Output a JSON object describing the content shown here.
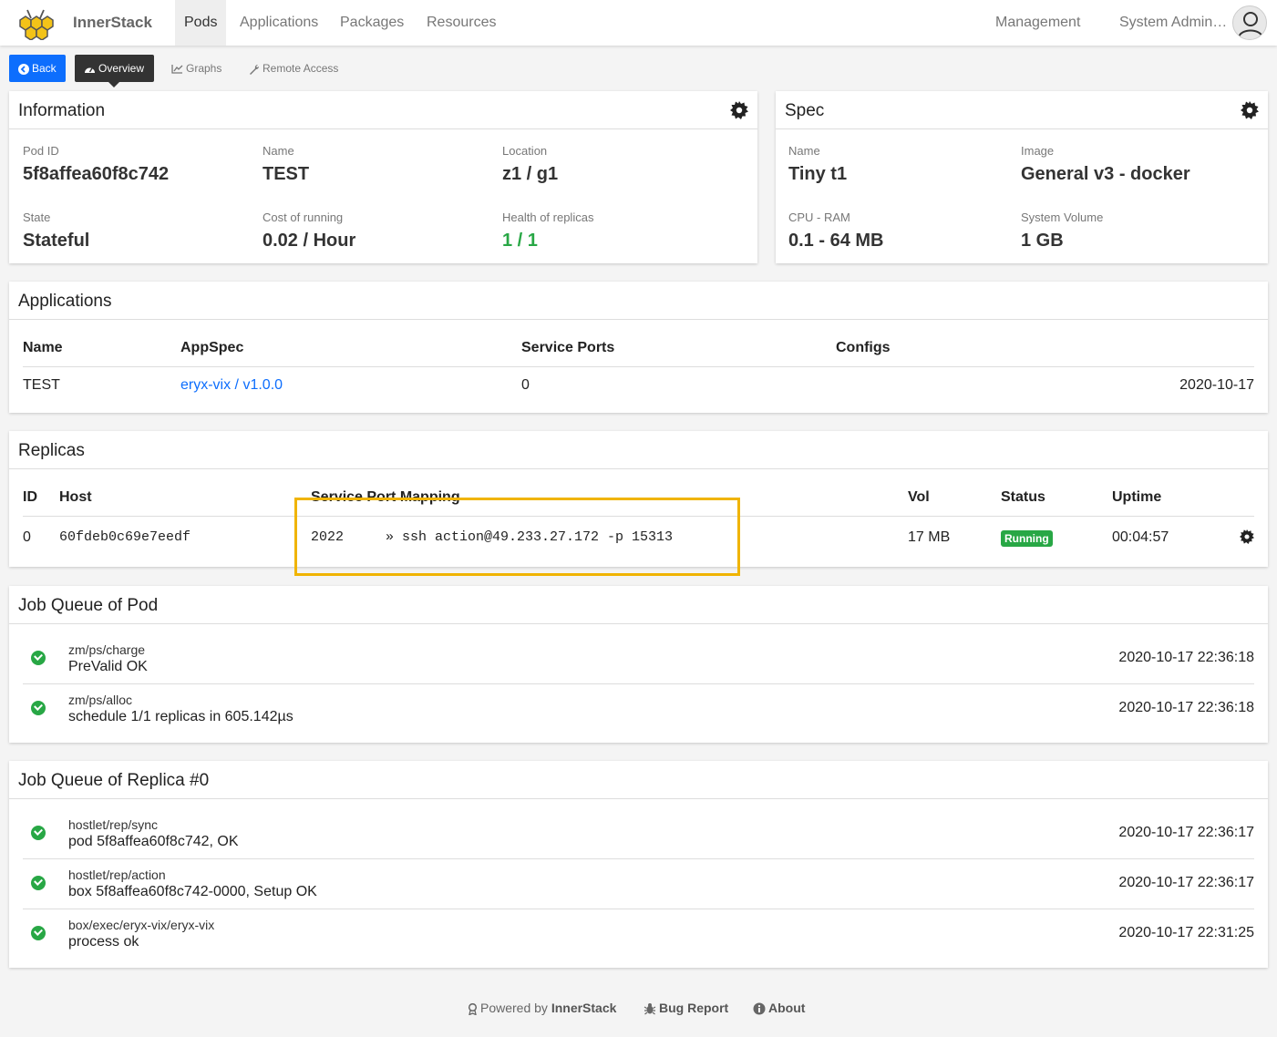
{
  "header": {
    "brand": "InnerStack",
    "nav": [
      "Pods",
      "Applications",
      "Packages",
      "Resources"
    ],
    "active_nav": "Pods",
    "management": "Management",
    "user": "System Administrator"
  },
  "subnav": {
    "back": "Back",
    "overview": "Overview",
    "graphs": "Graphs",
    "remote_access": "Remote Access"
  },
  "information": {
    "title": "Information",
    "pod_id_label": "Pod ID",
    "pod_id": "5f8affea60f8c742",
    "name_label": "Name",
    "name": "TEST",
    "location_label": "Location",
    "location": "z1 / g1",
    "state_label": "State",
    "state": "Stateful",
    "cost_label": "Cost of running",
    "cost": "0.02 / Hour",
    "health_label": "Health of replicas",
    "health": "1 / 1"
  },
  "spec": {
    "title": "Spec",
    "name_label": "Name",
    "name": "Tiny t1",
    "image_label": "Image",
    "image": "General v3 - docker",
    "cpu_label": "CPU - RAM",
    "cpu": "0.1 - 64 MB",
    "volume_label": "System Volume",
    "volume": "1 GB"
  },
  "applications": {
    "title": "Applications",
    "columns": [
      "Name",
      "AppSpec",
      "Service Ports",
      "Configs"
    ],
    "rows": [
      {
        "name": "TEST",
        "appspec": "eryx-vix / v1.0.0",
        "ports": "0",
        "date": "2020-10-17"
      }
    ]
  },
  "replicas": {
    "title": "Replicas",
    "columns": [
      "ID",
      "Host",
      "Service Port Mapping",
      "Vol",
      "Status",
      "Uptime"
    ],
    "rows": [
      {
        "id": "0",
        "host": "60fdeb0c69e7eedf",
        "port": "2022",
        "mapping": "» ssh action@49.233.27.172 -p 15313",
        "vol": "17 MB",
        "status": "Running",
        "uptime": "00:04:57"
      }
    ]
  },
  "job_queue_pod": {
    "title": "Job Queue of Pod",
    "items": [
      {
        "name": "zm/ps/charge",
        "msg": "PreValid OK",
        "time": "2020-10-17 22:36:18"
      },
      {
        "name": "zm/ps/alloc",
        "msg": "schedule 1/1 replicas in 605.142µs",
        "time": "2020-10-17 22:36:18"
      }
    ]
  },
  "job_queue_replica": {
    "title": "Job Queue of Replica #0",
    "items": [
      {
        "name": "hostlet/rep/sync",
        "msg": "pod 5f8affea60f8c742, OK",
        "time": "2020-10-17 22:36:17"
      },
      {
        "name": "hostlet/rep/action",
        "msg": "box 5f8affea60f8c742-0000, Setup OK",
        "time": "2020-10-17 22:36:17"
      },
      {
        "name": "box/exec/eryx-vix/eryx-vix",
        "msg": "process ok",
        "time": "2020-10-17 22:31:25"
      }
    ]
  },
  "footer": {
    "powered_prefix": "Powered by",
    "powered_brand": "InnerStack",
    "bug_report": "Bug Report",
    "about": "About"
  },
  "colors": {
    "primary": "#0d6efd",
    "success": "#28a745",
    "highlight": "#f0b400"
  }
}
